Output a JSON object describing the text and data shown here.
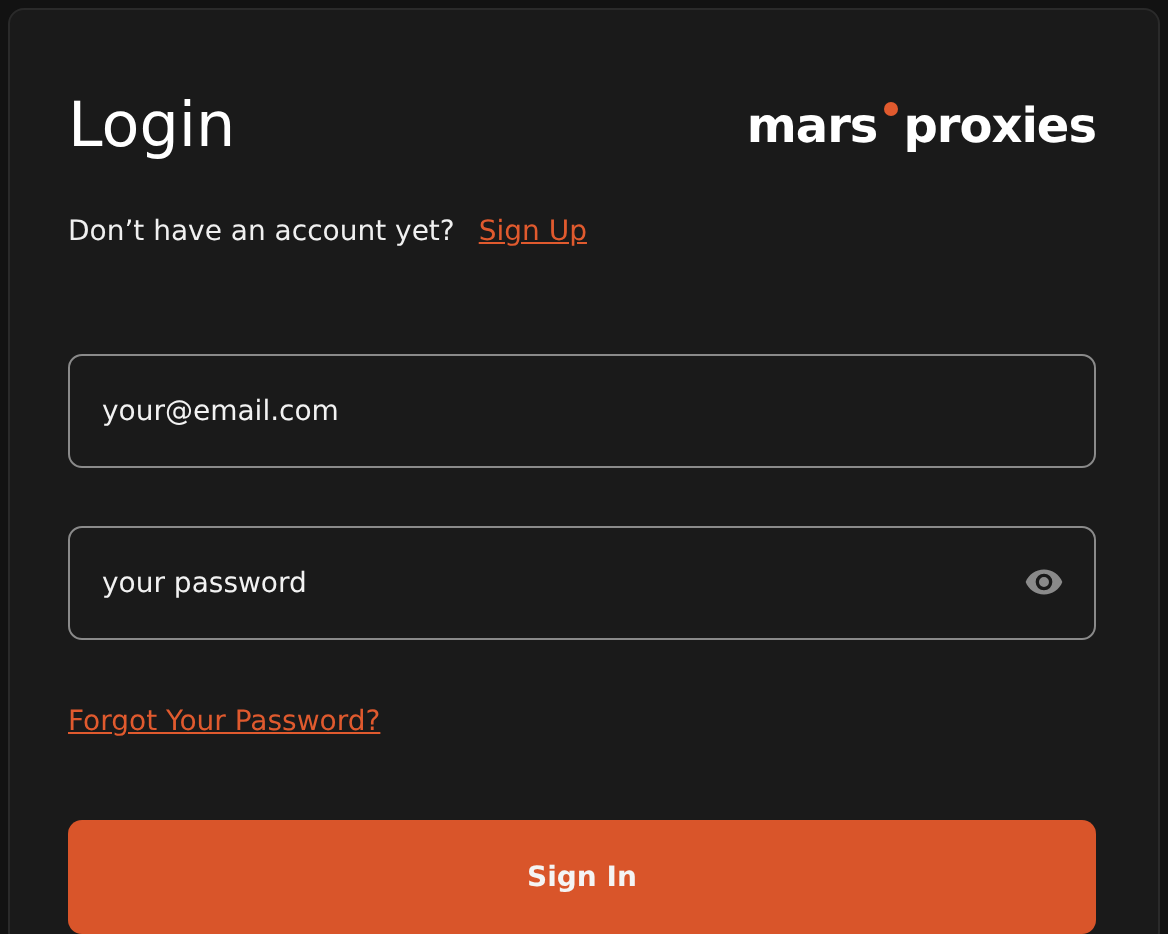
{
  "title": "Login",
  "logo": {
    "words": [
      "mars",
      "proxies"
    ]
  },
  "signup_prompt": {
    "text": "Don’t have an account yet?",
    "link": "Sign Up"
  },
  "email_field": {
    "placeholder": "your@email.com"
  },
  "password_field": {
    "placeholder": "your password",
    "show_toggle": true
  },
  "forgot_link": "Forgot Your Password?",
  "submit_button": "Sign In"
}
